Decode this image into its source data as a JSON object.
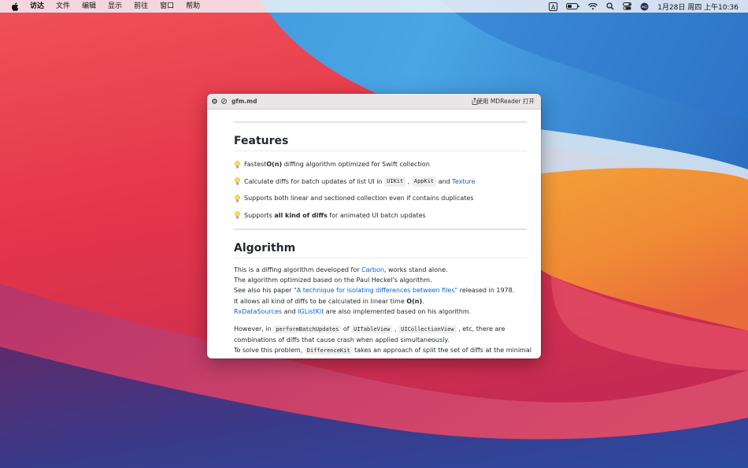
{
  "menubar": {
    "apple_icon": "apple-logo-icon",
    "app_name": "访达",
    "items": [
      "文件",
      "编辑",
      "显示",
      "前往",
      "窗口",
      "帮助"
    ],
    "status_icons": [
      "input-method-icon",
      "battery-icon",
      "wifi-icon",
      "spotlight-icon",
      "control-center-icon",
      "siri-icon"
    ],
    "input_method_label": "A",
    "clock": "1月28日 周四 上午10:36"
  },
  "window": {
    "title": "gfm.md",
    "open_with": "使用 MDReader 打开",
    "buttons": [
      "close-icon",
      "minimize-icon",
      "share-icon"
    ]
  },
  "doc": {
    "features_heading": "Features",
    "features": {
      "f1_a": "Fastest ",
      "f1_b": "O(n)",
      "f1_c": " diffing algorithm optimized for Swift collection",
      "f2_a": "Calculate diffs for batch updates of list UI in ",
      "f2_code1": "UIKit",
      "f2_sep1": " , ",
      "f2_code2": "AppKit",
      "f2_and": " and ",
      "f2_link": "Texture",
      "f3": "Supports both linear and sectioned collection even if contains duplicates",
      "f4_a": "Supports ",
      "f4_b": "all kind of diffs",
      "f4_c": " for animated UI batch updates"
    },
    "algorithm_heading": "Algorithm",
    "algo": {
      "l1_a": "This is a diffing algorithm developed for ",
      "l1_link": "Carbon",
      "l1_b": ", works stand alone.",
      "l2": "The algorithm optimized based on the Paul Heckel's algorithm.",
      "l3_a": "See also his paper ",
      "l3_link": "\"A technique for isolating differences between files\"",
      "l3_b": " released in 1978.",
      "l4_a": "It allows all kind of diffs to be calculated in linear time ",
      "l4_b": "O(n)",
      "l4_c": ".",
      "l5_link1": "RxDataSources",
      "l5_and": " and ",
      "l5_link2": "IGListKit",
      "l5_b": " are also implemented based on his algorithm.",
      "p2_a": "However, in ",
      "p2_code1": "performBatchUpdates",
      "p2_of": " of ",
      "p2_code2": "UITableView",
      "p2_sep": " , ",
      "p2_code3": "UICollectionView",
      "p2_b": " , etc, there are",
      "p2_l2": "combinations of diffs that cause crash when applied simultaneously.",
      "p2_l3_a": "To solve this problem, ",
      "p2_l3_code": "DifferenceKit",
      "p2_l3_b": " takes an approach of split the set of diffs at the minimal"
    }
  },
  "colors": {
    "link": "#0366d6",
    "text": "#24292e",
    "menubar": "#f5f5fa"
  }
}
